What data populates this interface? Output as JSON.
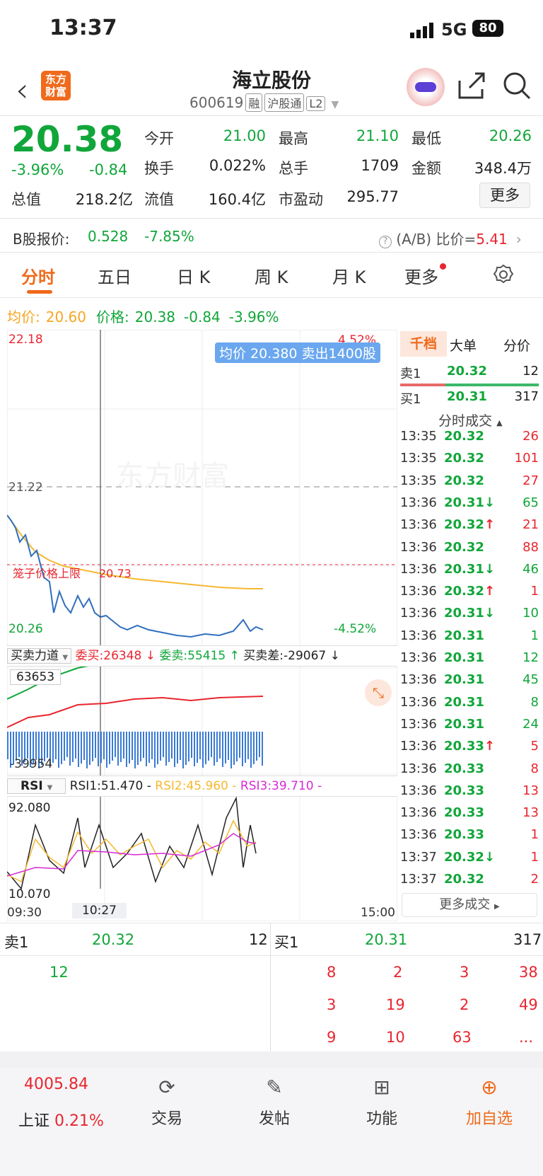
{
  "status": {
    "time": "13:37",
    "network": "5G",
    "battery": "80"
  },
  "header": {
    "logo": "东方\n财富",
    "title": "海立股份",
    "code": "600619",
    "tags": [
      "融",
      "沪股通",
      "L2"
    ]
  },
  "quote": {
    "price": "20.38",
    "pct": "-3.96%",
    "chg": "-0.84",
    "rows": [
      [
        {
          "l": "今开",
          "v": "21.00",
          "c": "g"
        },
        {
          "l": "最高",
          "v": "21.10",
          "c": "g"
        },
        {
          "l": "最低",
          "v": "20.26",
          "c": "g"
        }
      ],
      [
        {
          "l": "换手",
          "v": "0.022%",
          "c": ""
        },
        {
          "l": "总手",
          "v": "1709",
          "c": ""
        },
        {
          "l": "金额",
          "v": "348.4万",
          "c": ""
        }
      ],
      [
        {
          "l": "总值",
          "v": "218.2亿",
          "c": ""
        },
        {
          "l": "流值",
          "v": "160.4亿",
          "c": ""
        },
        {
          "l": "市盈动",
          "v": "295.77",
          "c": ""
        }
      ]
    ],
    "more": "更多"
  },
  "bshare": {
    "label": "B股报价:",
    "price": "0.528",
    "pct": "-7.85%",
    "ratio_label": "(A/B) 比价=",
    "ratio": "5.41"
  },
  "tabs": [
    "分时",
    "五日",
    "日 K",
    "周 K",
    "月 K",
    "更多"
  ],
  "avgline": {
    "avg_label": "均价:",
    "avg": "20.60",
    "price_label": "价格:",
    "price": "20.38",
    "chg": "-0.84",
    "pct": "-3.96%"
  },
  "chart": {
    "ymax": "22.18",
    "ymid": "21.22",
    "ymin": "20.26",
    "pct_top": "4.52%",
    "pct_bot": "-4.52%",
    "tooltip": "均价 20.380 卖出1400股",
    "limit_label": "笼子价格上限",
    "limit_val": "20.73",
    "watermark": "东方财富",
    "t_start": "09:30",
    "t_cursor": "10:27",
    "t_end": "15:00"
  },
  "chart_data": {
    "type": "line",
    "series": [
      {
        "name": "价格",
        "values": [
          20.95,
          20.7,
          20.55,
          20.42,
          20.33,
          20.3,
          20.32,
          20.29,
          20.28,
          20.31,
          20.3,
          20.29,
          20.29,
          20.32,
          20.3
        ]
      },
      {
        "name": "均价",
        "values": [
          20.95,
          20.82,
          20.74,
          20.7,
          20.67,
          20.65,
          20.64,
          20.63,
          20.62,
          20.62,
          20.61,
          20.61,
          20.6,
          20.6,
          20.6
        ]
      }
    ],
    "ylim": [
      20.26,
      22.18
    ]
  },
  "force": {
    "name": "买卖力道",
    "buy_label": "委买:",
    "buy": "26348 ↓",
    "sell_label": "委卖:",
    "sell": "55415 ↑",
    "diff_label": "买卖差:",
    "diff": "-29067 ↓",
    "top": "63653",
    "bot": "-39954"
  },
  "rsi": {
    "name": "RSI",
    "r1": "RSI1:51.470 -",
    "r2": "RSI2:45.960 -",
    "r3": "RSI3:39.710 -",
    "top": "92.080",
    "bot": "10.070"
  },
  "right": {
    "tabs": [
      "千档",
      "大单",
      "分价"
    ],
    "sell1": {
      "l": "卖1",
      "p": "20.32",
      "v": "12"
    },
    "buy1": {
      "l": "买1",
      "p": "20.31",
      "v": "317"
    },
    "title": "分时成交",
    "more": "更多成交",
    "trades": [
      [
        "13:35",
        "20.32",
        "",
        "26",
        "r"
      ],
      [
        "13:35",
        "20.32",
        "",
        "101",
        "r"
      ],
      [
        "13:35",
        "20.32",
        "",
        "27",
        "r"
      ],
      [
        "13:36",
        "20.31",
        "↓",
        "65",
        "g"
      ],
      [
        "13:36",
        "20.32",
        "↑",
        "21",
        "r"
      ],
      [
        "13:36",
        "20.32",
        "",
        "88",
        "r"
      ],
      [
        "13:36",
        "20.31",
        "↓",
        "46",
        "g"
      ],
      [
        "13:36",
        "20.32",
        "↑",
        "1",
        "r"
      ],
      [
        "13:36",
        "20.31",
        "↓",
        "10",
        "g"
      ],
      [
        "13:36",
        "20.31",
        "",
        "1",
        "g"
      ],
      [
        "13:36",
        "20.31",
        "",
        "12",
        "g"
      ],
      [
        "13:36",
        "20.31",
        "",
        "45",
        "g"
      ],
      [
        "13:36",
        "20.31",
        "",
        "8",
        "g"
      ],
      [
        "13:36",
        "20.31",
        "",
        "24",
        "g"
      ],
      [
        "13:36",
        "20.33",
        "↑",
        "5",
        "r"
      ],
      [
        "13:36",
        "20.33",
        "",
        "8",
        "r"
      ],
      [
        "13:36",
        "20.33",
        "",
        "13",
        "r"
      ],
      [
        "13:36",
        "20.33",
        "",
        "13",
        "r"
      ],
      [
        "13:36",
        "20.33",
        "",
        "1",
        "r"
      ],
      [
        "13:37",
        "20.32",
        "↓",
        "1",
        "r"
      ],
      [
        "13:37",
        "20.32",
        "",
        "2",
        "r"
      ]
    ]
  },
  "book": {
    "sell_label": "卖1",
    "sell_price": "20.32",
    "sell_vol": "12",
    "buy_label": "买1",
    "buy_price": "20.31",
    "buy_vol": "317",
    "sell_q": [
      "12"
    ],
    "buy_q": [
      "8",
      "2",
      "3",
      "38",
      "3",
      "19",
      "2",
      "49",
      "9",
      "10",
      "63",
      "..."
    ]
  },
  "nav": {
    "index": "4005.84",
    "index_name": "上证",
    "index_pct": "0.21%",
    "items": [
      "交易",
      "发帖",
      "功能",
      "加自选"
    ]
  }
}
